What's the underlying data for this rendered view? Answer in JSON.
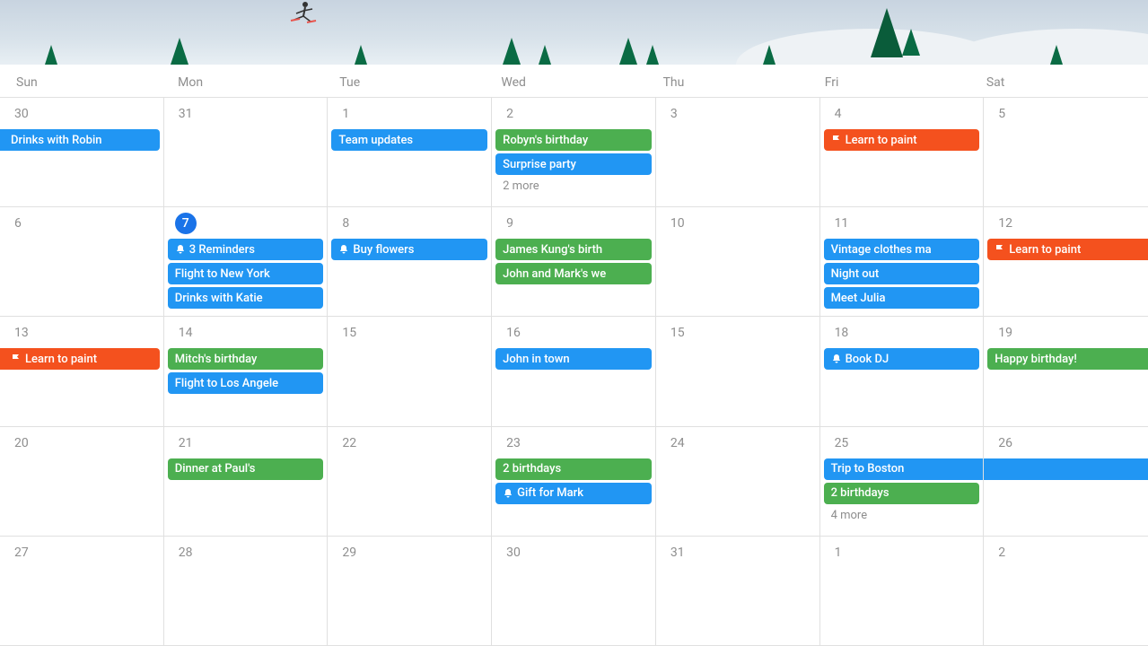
{
  "dayHeaders": [
    "Sun",
    "Mon",
    "Tue",
    "Wed",
    "Thu",
    "Fri",
    "Sat"
  ],
  "today": 7,
  "rows": [
    [
      {
        "num": "30",
        "events": [
          {
            "label": "Drinks with Robin",
            "color": "blue",
            "edge": "l"
          }
        ]
      },
      {
        "num": "31",
        "events": []
      },
      {
        "num": "1",
        "events": [
          {
            "label": "Team updates",
            "color": "blue"
          }
        ]
      },
      {
        "num": "2",
        "events": [
          {
            "label": "Robyn's birthday",
            "color": "green"
          },
          {
            "label": "Surprise party",
            "color": "blue"
          }
        ],
        "more": "2 more"
      },
      {
        "num": "3",
        "events": []
      },
      {
        "num": "4",
        "events": [
          {
            "label": "Learn to paint",
            "color": "orange",
            "icon": "flag"
          }
        ]
      },
      {
        "num": "5",
        "events": []
      }
    ],
    [
      {
        "num": "6",
        "events": []
      },
      {
        "num": "7",
        "today": true,
        "events": [
          {
            "label": "3 Reminders",
            "color": "blue",
            "icon": "reminder"
          },
          {
            "label": "Flight to New York",
            "color": "blue"
          },
          {
            "label": "Drinks with Katie",
            "color": "blue"
          }
        ]
      },
      {
        "num": "8",
        "events": [
          {
            "label": "Buy flowers",
            "color": "blue",
            "icon": "reminder"
          }
        ]
      },
      {
        "num": "9",
        "events": [
          {
            "label": "James Kung's birth",
            "color": "green"
          },
          {
            "label": "John and Mark's we",
            "color": "green"
          }
        ]
      },
      {
        "num": "10",
        "events": []
      },
      {
        "num": "11",
        "events": [
          {
            "label": "Vintage clothes ma",
            "color": "blue"
          },
          {
            "label": "Night out",
            "color": "blue"
          },
          {
            "label": "Meet Julia",
            "color": "blue"
          }
        ]
      },
      {
        "num": "12",
        "events": [
          {
            "label": "Learn to paint",
            "color": "orange",
            "icon": "flag",
            "edge": "r"
          }
        ]
      }
    ],
    [
      {
        "num": "13",
        "events": [
          {
            "label": "Learn to paint",
            "color": "orange",
            "icon": "flag",
            "edge": "l"
          }
        ]
      },
      {
        "num": "14",
        "events": [
          {
            "label": "Mitch's birthday",
            "color": "green"
          },
          {
            "label": "Flight to Los Angele",
            "color": "blue"
          }
        ]
      },
      {
        "num": "15",
        "events": []
      },
      {
        "num": "16",
        "events": [
          {
            "label": "John in town",
            "color": "blue"
          }
        ]
      },
      {
        "num": "15",
        "events": []
      },
      {
        "num": "18",
        "events": [
          {
            "label": "Book DJ",
            "color": "blue",
            "icon": "reminder"
          }
        ]
      },
      {
        "num": "19",
        "events": [
          {
            "label": "Happy birthday!",
            "color": "green",
            "edge": "r"
          }
        ]
      }
    ],
    [
      {
        "num": "20",
        "events": []
      },
      {
        "num": "21",
        "events": [
          {
            "label": "Dinner at Paul's",
            "color": "green"
          }
        ]
      },
      {
        "num": "22",
        "events": []
      },
      {
        "num": "23",
        "events": [
          {
            "label": "2 birthdays",
            "color": "green"
          },
          {
            "label": "Gift for Mark",
            "color": "blue",
            "icon": "reminder"
          }
        ]
      },
      {
        "num": "24",
        "events": []
      },
      {
        "num": "25",
        "events": [
          {
            "label": "Trip to Boston",
            "color": "blue",
            "edge": "r"
          },
          {
            "label": "2 birthdays",
            "color": "green"
          }
        ],
        "more": "4 more"
      },
      {
        "num": "26",
        "events": [
          {
            "label": "",
            "color": "blue",
            "cont": true,
            "edge": "lr"
          }
        ]
      }
    ],
    [
      {
        "num": "27",
        "events": []
      },
      {
        "num": "28",
        "events": []
      },
      {
        "num": "29",
        "events": []
      },
      {
        "num": "30",
        "events": []
      },
      {
        "num": "31",
        "events": []
      },
      {
        "num": "1",
        "events": []
      },
      {
        "num": "2",
        "events": []
      }
    ]
  ]
}
